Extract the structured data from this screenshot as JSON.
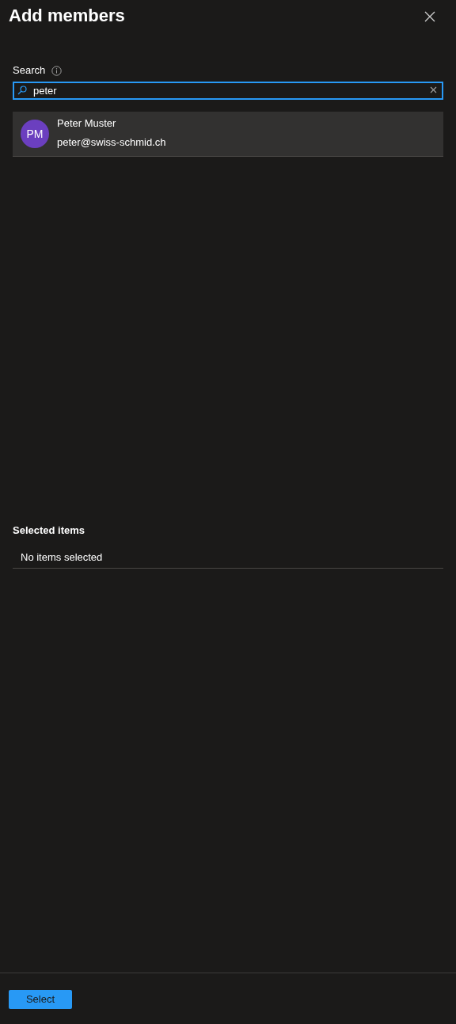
{
  "panel": {
    "title": "Add members"
  },
  "search": {
    "label": "Search",
    "value": "peter",
    "focused": true
  },
  "results": [
    {
      "initials": "PM",
      "name": "Peter Muster",
      "email": "peter@swiss-schmid.ch",
      "color": "#6b3fbf",
      "hovered": true
    }
  ],
  "selected_items": {
    "heading": "Selected items",
    "empty_text": "No items selected"
  },
  "footer": {
    "button": "Select"
  }
}
